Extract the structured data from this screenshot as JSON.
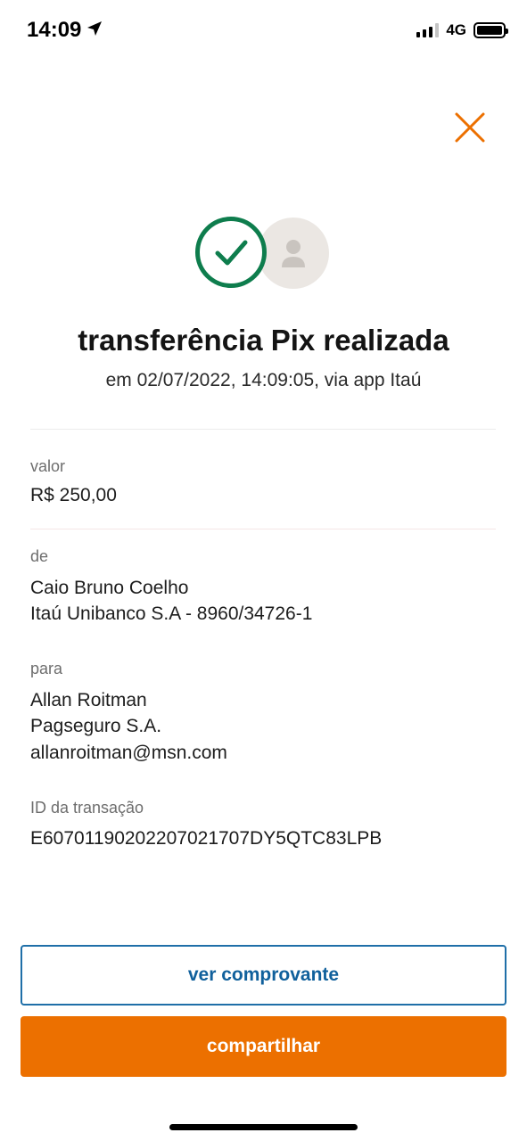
{
  "status_bar": {
    "time": "14:09",
    "network": "4G"
  },
  "header": {
    "title": "transferência Pix realizada",
    "subtitle": "em 02/07/2022, 14:09:05, via app Itaú"
  },
  "details": {
    "valor_label": "valor",
    "valor_value": "R$ 250,00",
    "de_label": "de",
    "de_name": "Caio Bruno Coelho",
    "de_bank": "Itaú Unibanco S.A - 8960/34726-1",
    "para_label": "para",
    "para_name": "Allan Roitman",
    "para_bank": "Pagseguro S.A.",
    "para_key": "allanroitman@msn.com",
    "id_label": "ID da transação",
    "id_value": "E60701190202207021707DY5QTC83LPB"
  },
  "actions": {
    "ver_comprovante": "ver comprovante",
    "compartilhar": "compartilhar"
  },
  "colors": {
    "accent": "#ec7000",
    "success": "#0e7d4d",
    "link": "#10609c"
  }
}
